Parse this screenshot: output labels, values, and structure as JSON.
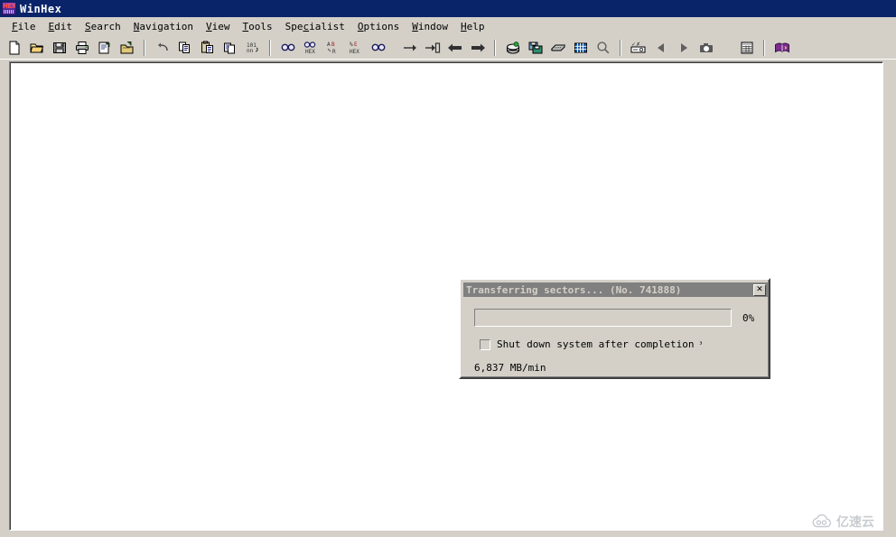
{
  "window": {
    "title": "WinHex",
    "app_icon": "hex-icon",
    "titlebar_color": "#0a246a",
    "face_color": "#d4d0c8"
  },
  "menubar": {
    "items": [
      {
        "label": "File",
        "mnemonic": "F"
      },
      {
        "label": "Edit",
        "mnemonic": "E"
      },
      {
        "label": "Search",
        "mnemonic": "S"
      },
      {
        "label": "Navigation",
        "mnemonic": "N"
      },
      {
        "label": "View",
        "mnemonic": "V"
      },
      {
        "label": "Tools",
        "mnemonic": "T"
      },
      {
        "label": "Specialist",
        "mnemonic": "c"
      },
      {
        "label": "Options",
        "mnemonic": "O"
      },
      {
        "label": "Window",
        "mnemonic": "W"
      },
      {
        "label": "Help",
        "mnemonic": "H"
      }
    ]
  },
  "toolbar": {
    "groups": [
      {
        "buttons": [
          {
            "icon": "new-file-icon",
            "tooltip": "New"
          },
          {
            "icon": "open-folder-icon",
            "tooltip": "Open"
          },
          {
            "icon": "save-icon",
            "tooltip": "Save"
          },
          {
            "icon": "print-icon",
            "tooltip": "Print"
          },
          {
            "icon": "properties-icon",
            "tooltip": "Properties"
          },
          {
            "icon": "open-disk-icon",
            "tooltip": "Open Disk"
          }
        ]
      },
      {
        "buttons": [
          {
            "icon": "undo-icon",
            "tooltip": "Undo"
          },
          {
            "icon": "copy-icon",
            "tooltip": "Copy"
          },
          {
            "icon": "paste-icon",
            "tooltip": "Paste"
          },
          {
            "icon": "clipboard-icon",
            "tooltip": "Clipboard Data"
          },
          {
            "icon": "hex-convert-icon",
            "tooltip": "Convert"
          }
        ]
      },
      {
        "buttons": [
          {
            "icon": "find-text-icon",
            "tooltip": "Find Text"
          },
          {
            "icon": "find-hex-icon",
            "tooltip": "Find Hex Values"
          },
          {
            "icon": "replace-text-icon",
            "tooltip": "Replace Text"
          },
          {
            "icon": "replace-hex-icon",
            "tooltip": "Replace Hex Values"
          },
          {
            "icon": "find-again-icon",
            "tooltip": "Continue Search"
          }
        ]
      },
      {
        "buttons": [
          {
            "icon": "goto-icon",
            "tooltip": "Go To Offset"
          },
          {
            "icon": "goto-offset-icon",
            "tooltip": "Go To"
          },
          {
            "icon": "back-icon",
            "tooltip": "Back"
          },
          {
            "icon": "forward-icon",
            "tooltip": "Forward"
          }
        ]
      },
      {
        "buttons": [
          {
            "icon": "disk-editor-icon",
            "tooltip": "Open Disk"
          },
          {
            "icon": "disk-backup-icon",
            "tooltip": "Create Disk Image"
          },
          {
            "icon": "ram-editor-icon",
            "tooltip": "RAM Editor"
          },
          {
            "icon": "data-grid-icon",
            "tooltip": "Data Interpreter"
          },
          {
            "icon": "magnifier-icon",
            "tooltip": "Analyze"
          }
        ]
      },
      {
        "buttons": [
          {
            "icon": "checksum-icon",
            "tooltip": "Compute Hash"
          },
          {
            "icon": "prev-icon",
            "tooltip": "Previous"
          },
          {
            "icon": "next-icon",
            "tooltip": "Next"
          },
          {
            "icon": "camera-icon",
            "tooltip": "Snapshot"
          }
        ]
      },
      {
        "buttons": [
          {
            "icon": "report-table-icon",
            "tooltip": "Case Data"
          }
        ]
      },
      {
        "buttons": [
          {
            "icon": "help-book-icon",
            "tooltip": "Help"
          }
        ]
      }
    ]
  },
  "client_area": {
    "background": "#ffffff",
    "content": ""
  },
  "dialog": {
    "title": "Transferring sectors... (No. 741888)",
    "close_label": "✕",
    "progress": {
      "percent_label": "0%",
      "percent_value": 0
    },
    "shutdown_checkbox": {
      "label": "Shut down system after completion",
      "checked": false,
      "trailing_mark": "³"
    },
    "speed": "6,837 MB/min"
  },
  "watermark": {
    "text": "亿速云",
    "icon": "cloud-icon"
  }
}
